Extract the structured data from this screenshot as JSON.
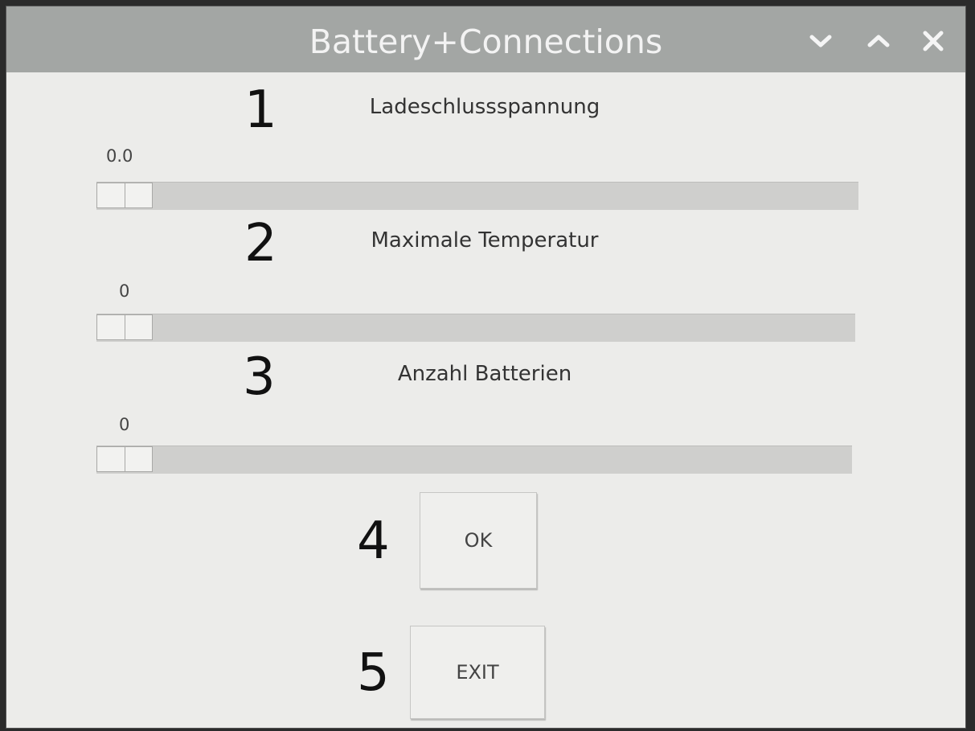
{
  "window": {
    "title": "Battery+Connections",
    "controls": {
      "minimize_icon": "chevron-down-icon",
      "maximize_icon": "chevron-up-icon",
      "close_icon": "close-icon"
    }
  },
  "sliders": [
    {
      "marker": "1",
      "label": "Ladeschlussspannung",
      "value": "0.0",
      "fraction": 0
    },
    {
      "marker": "2",
      "label": "Maximale Temperatur",
      "value": "0",
      "fraction": 0
    },
    {
      "marker": "3",
      "label": "Anzahl Batterien",
      "value": "0",
      "fraction": 0
    }
  ],
  "buttons": {
    "ok": {
      "marker": "4",
      "label": "OK"
    },
    "exit": {
      "marker": "5",
      "label": "EXIT"
    }
  },
  "colors": {
    "titlebar": "#a3a6a4",
    "window_bg": "#ececea",
    "track": "#cfcfcd"
  }
}
